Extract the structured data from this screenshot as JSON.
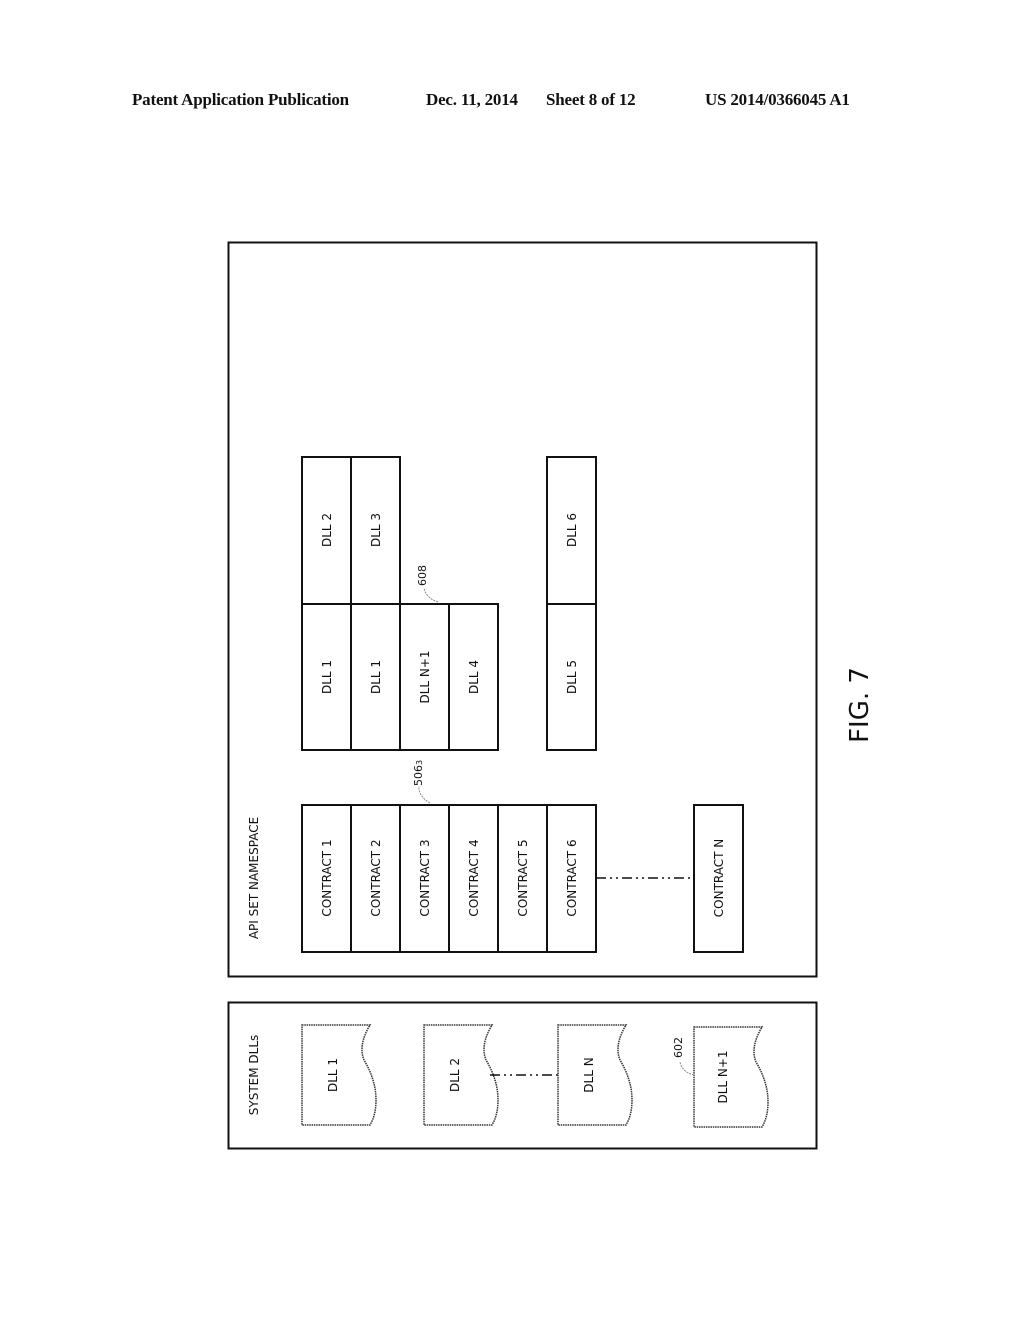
{
  "header": {
    "publication": "Patent Application Publication",
    "date": "Dec. 11, 2014",
    "sheet": "Sheet 8 of 12",
    "number": "US 2014/0366045 A1"
  },
  "figure": {
    "label": "FIG. 7",
    "api_set_namespace": {
      "title": "API SET NAMESPACE",
      "contracts": [
        "CONTRACT 1",
        "CONTRACT 2",
        "CONTRACT 3",
        "CONTRACT 4",
        "CONTRACT 5",
        "CONTRACT 6"
      ],
      "contract_last": "CONTRACT N",
      "contract_ref": "506",
      "contract_ref_sub": "3",
      "dll_lower_row": [
        "DLL 1",
        "DLL 1",
        "DLL N+1",
        "DLL 4"
      ],
      "dll_upper_row": [
        "DLL 2",
        "DLL 3"
      ],
      "dll_extra_lower": "DLL 5",
      "dll_extra_upper": "DLL 6",
      "dll_ref": "608"
    },
    "system_dlls": {
      "title": "SYSTEM DLLs",
      "dlls": [
        "DLL 1",
        "DLL 2",
        "DLL N",
        "DLL N+1"
      ],
      "new_dll_ref": "602"
    }
  }
}
